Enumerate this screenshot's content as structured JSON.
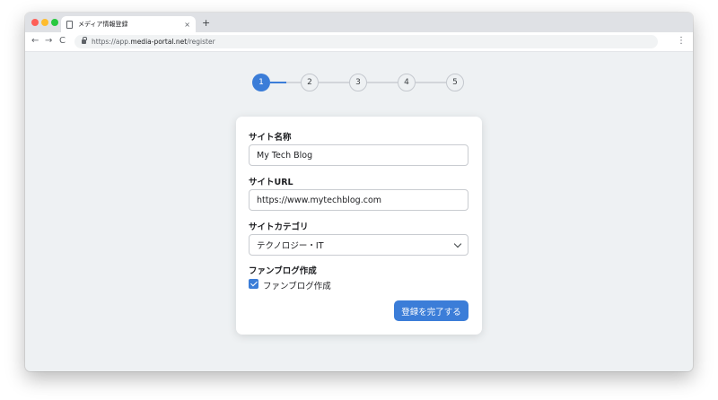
{
  "browser": {
    "tab_title": "メディア情報登録",
    "tab_close": "×",
    "new_tab": "+",
    "url_prefix": "https://app.",
    "url_host": "media-portal.net",
    "url_path": "/register",
    "nav_back": "←",
    "nav_forward": "→",
    "nav_reload": "C",
    "menu": "⋮"
  },
  "stepper": {
    "current": 1,
    "steps": [
      "1",
      "2",
      "3",
      "4",
      "5"
    ]
  },
  "form": {
    "site_name": {
      "label": "サイト名称",
      "value": "My Tech Blog"
    },
    "site_url": {
      "label": "サイトURL",
      "value": "https://www.mytechblog.com"
    },
    "site_category": {
      "label": "サイトカテゴリ",
      "value": "テクノロジー・IT"
    },
    "fan_blog": {
      "label": "ファンブログ作成",
      "checkbox_label": "ファンブログ作成",
      "checked": true
    },
    "submit_label": "登録を完了する"
  },
  "colors": {
    "accent": "#3b7dd8",
    "page_bg": "#eef1f3"
  }
}
